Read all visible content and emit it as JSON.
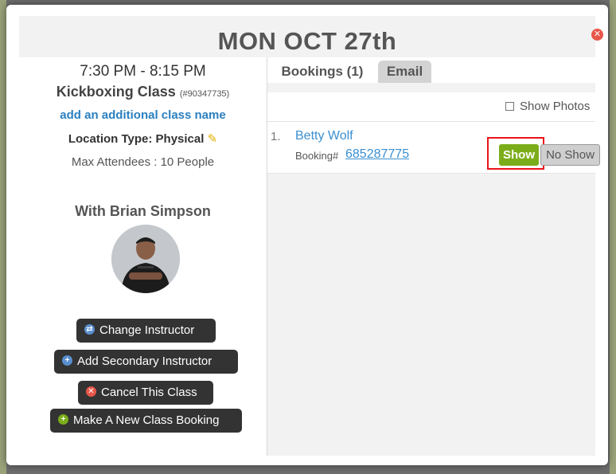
{
  "modal": {
    "date_title": "MON OCT 27th",
    "close_icon": "close-icon"
  },
  "class_info": {
    "time": "7:30 PM - 8:15 PM",
    "name": "Kickboxing Class",
    "id": "(#90347735)",
    "add_name_link": "add an additional class name",
    "location": "Location Type: Physical",
    "max_attendees": "Max Attendees : 10 People",
    "instructor": "With Brian Simpson"
  },
  "actions": {
    "change_instructor": "Change Instructor",
    "add_secondary": "Add Secondary Instructor",
    "cancel_class": "Cancel This Class",
    "new_booking": "Make A New Class Booking"
  },
  "tabs": {
    "bookings": "Bookings (1)",
    "email": "Email"
  },
  "options": {
    "show_photos": "Show Photos"
  },
  "bookings": [
    {
      "index": "1.",
      "name": "Betty Wolf",
      "booking_label": "Booking#",
      "booking_number": "685287775",
      "show_label": "Show",
      "no_show_label": "No Show"
    }
  ],
  "colors": {
    "show_button": "#7bad1a",
    "link": "#2a7fbf",
    "highlight": "#e8141b",
    "close": "#e8564a"
  }
}
